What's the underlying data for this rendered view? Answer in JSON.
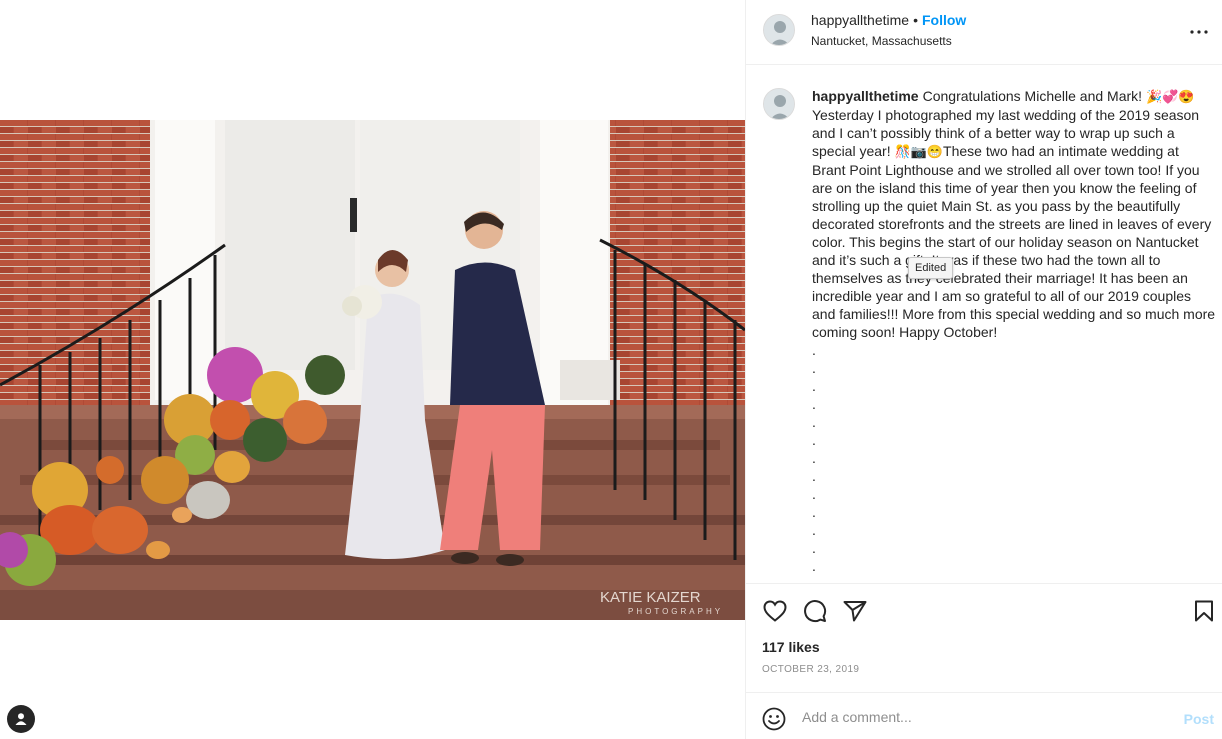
{
  "post": {
    "username": "happyallthetime",
    "separator": "•",
    "follow_label": "Follow",
    "location": "Nantucket, Massachusetts",
    "photo_watermark": "KATIE KAIZER",
    "photo_watermark_sub": "PHOTOGRAPHY"
  },
  "caption": {
    "username": "happyallthetime",
    "lead": "Congratulations Michelle and Mark!",
    "lead_emoji": "🎉💞😍",
    "line2": "Yesterday I photographed my last wedding of the 2019 season and I can’t possibly think of a better way to wrap up such a special year!",
    "line2_emoji": "🎊📷😁",
    "body": "These two had an intimate wedding at Brant Point Lighthouse and we strolled all over town too! If you are on the island this time of year then you know the feeling of strolling up the quiet Main St. as you pass by the beautifully decorated storefronts and the streets are lined in leaves of every color. This begins the start of our holiday season on Nantucket and it’s such a gift. It was if these two had the town all to themselves as they celebrated their marriage! It has been an incredible year and I am so grateful to all of our 2019 couples and families!!! More from this special wedding and so much more coming soon! Happy October!",
    "dots": [
      ".",
      ".",
      ".",
      ".",
      ".",
      ".",
      ".",
      ".",
      ".",
      ".",
      ".",
      ".",
      "."
    ],
    "edited_tooltip": "Edited"
  },
  "engagement": {
    "likes": "117 likes",
    "date": "OCTOBER 23, 2019"
  },
  "comment_bar": {
    "placeholder": "Add a comment...",
    "post_label": "Post"
  },
  "icons": {
    "like": "heart-icon",
    "comment": "comment-bubble-icon",
    "share": "paper-plane-icon",
    "save": "bookmark-icon",
    "more": "more-options-icon",
    "emoji": "smiley-icon",
    "tag": "user-tag-icon"
  },
  "colors": {
    "link_blue": "#0095f6",
    "post_disabled": "#b2dffc",
    "muted": "#8e8e8e",
    "text": "#262626",
    "divider": "#efefef"
  }
}
